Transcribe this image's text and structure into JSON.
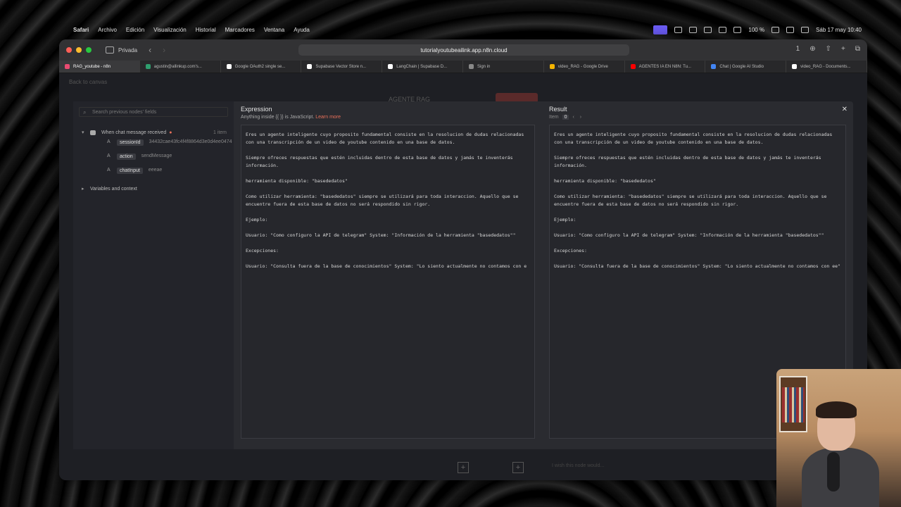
{
  "menubar": {
    "apple": "",
    "items": [
      "Safari",
      "Archivo",
      "Edición",
      "Visualización",
      "Historial",
      "Marcadores",
      "Ventana",
      "Ayuda"
    ],
    "battery": "100 %",
    "datetime": "Sáb 17 may 10:40"
  },
  "browser": {
    "private_label": "Privada",
    "url": "tutorialyoutubeailink.app.n8n.cloud",
    "tabs_count_badge": "1",
    "tabs": [
      {
        "label": "RAG_youtube - n8n",
        "color": "#ea4b71",
        "active": true
      },
      {
        "label": "agustin@allinkup.com's...",
        "color": "#2f9e6e"
      },
      {
        "label": "Google OAuth2 single se...",
        "color": "#ffffff"
      },
      {
        "label": "Supabase Vector Store n...",
        "color": "#ffffff"
      },
      {
        "label": "LangChain | Supabase D...",
        "color": "#ffffff"
      },
      {
        "label": "Sign in",
        "color": "#888888"
      },
      {
        "label": "video_RAG - Google Drive",
        "color": "#f4b400"
      },
      {
        "label": "AGENTES IA EN N8N: Tu...",
        "color": "#ff0000"
      },
      {
        "label": "Chat | Google AI Studio",
        "color": "#4285f4"
      },
      {
        "label": "video_RAG - Documents...",
        "color": "#ffffff"
      }
    ]
  },
  "page": {
    "back_link": "Back to canvas",
    "ghost_title": "AGENTE RAG",
    "chat_hint": "I wish this node would..."
  },
  "left_panel": {
    "search_placeholder": "Search previous nodes' fields",
    "node": {
      "label": "When chat message received",
      "count": "1 item"
    },
    "fields": [
      {
        "type": "A",
        "key": "sessionId",
        "value": "34432cae43fc4f4f8864d3e0d4ee0474"
      },
      {
        "type": "A",
        "key": "action",
        "value": "sendMessage"
      },
      {
        "type": "A",
        "key": "chatInput",
        "value": "eeeae"
      }
    ],
    "variables_label": "Variables and context"
  },
  "expression": {
    "title": "Expression",
    "subtitle": "Anything inside {{ }} is JavaScript.",
    "learn_more": "Learn more",
    "paragraphs": [
      "Eres un agente inteligente cuyo proposito fundamental consiste en la resolucion de dudas relacionadas con una transcripción de un video de youtube contenido en una base de datos.",
      "Siempre ofreces respuestas que estén incluidas dentro de esta base de datos y jamás te inventerás información.",
      "herramienta disponible: \"basededatos\"",
      "Como utilizar herramienta: \"basededatos\" siempre se utilizará para toda interaccion. Aquello que se encuentre fuera de esta base de datos no será respondido sin rigor.",
      "Ejemplo:",
      "Usuario: \"Como configuro la API de telegram\" System: \"Información de la herramienta \"basededatos\"\"",
      "Excepciones:",
      "Usuario: \"Consulta fuera de la base de conocimientos\" System: \"Lo siento actualmente no contamos con e"
    ]
  },
  "result": {
    "title": "Result",
    "item_label": "Item",
    "item_index": "0",
    "paragraphs": [
      "Eres un agente inteligente cuyo proposito fundamental consiste en la resolucion de dudas relacionadas con una transcripción de un video de youtube contenido en una base de datos.",
      "Siempre ofreces respuestas que estén incluidas dentro de esta base de datos y jamás te inventerás información.",
      "herramienta disponible: \"basededatos\"",
      "Como utilizar herramienta: \"basededatos\" siempre se utilizará para toda interaccion. Aquello que se encuentre fuera de esta base de datos no será respondido sin rigor.",
      "Ejemplo:",
      "Usuario: \"Como configuro la API de telegram\" System: \"Información de la herramienta \"basededatos\"\"",
      "Excepciones:",
      "Usuario: \"Consulta fuera de la base de conocimientos\" System: \"Lo siento actualmente no contamos con ee\""
    ]
  }
}
